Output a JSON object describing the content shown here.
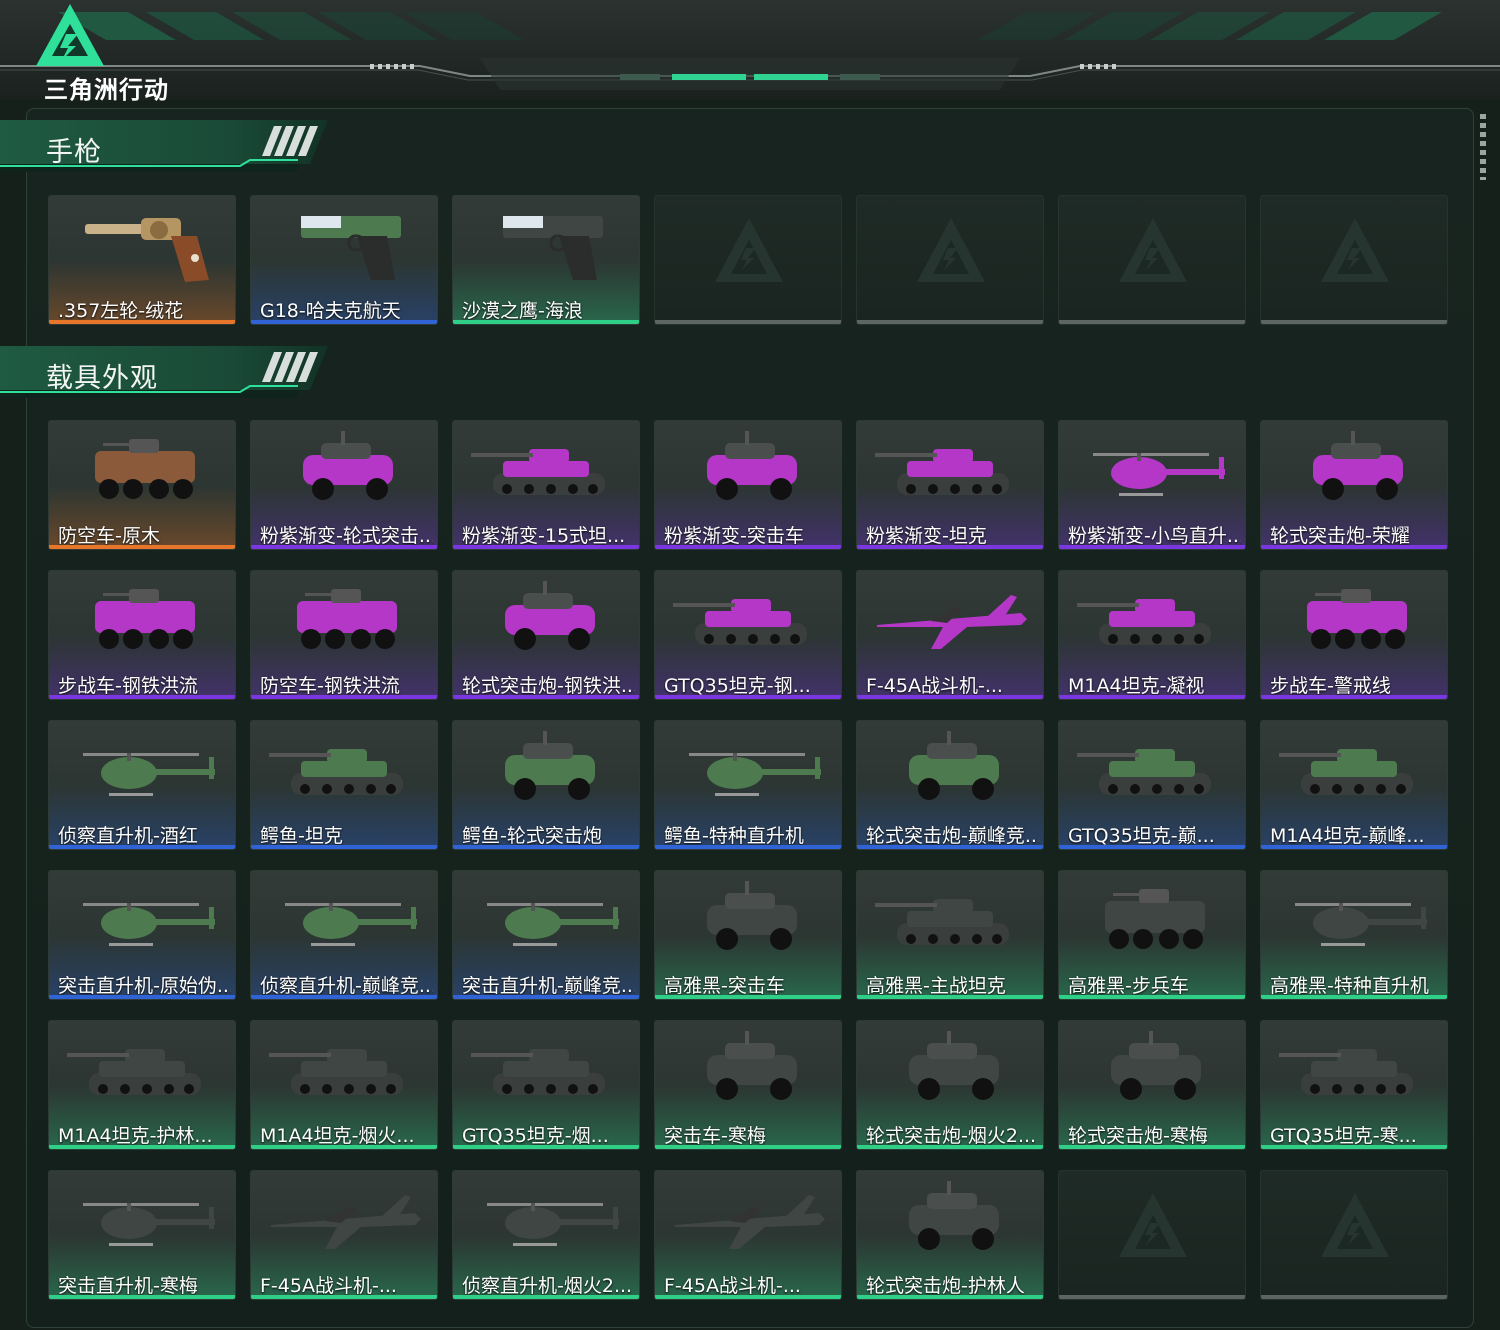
{
  "game": {
    "logo_text": "三角洲行动"
  },
  "rarity_colors": {
    "orange": "#e8762a",
    "blue": "#2f63d6",
    "purple": "#7a37e0",
    "green": "#2fcf88",
    "empty": "#5c6561"
  },
  "sections": [
    {
      "title": "手枪",
      "items": [
        {
          "label": ".357左轮-绒花",
          "rarity": "orange",
          "icon": "revolver"
        },
        {
          "label": "G18-哈夫克航天",
          "rarity": "blue",
          "icon": "pistol"
        },
        {
          "label": "沙漠之鹰-海浪",
          "rarity": "green",
          "icon": "pistol"
        },
        {
          "label": "",
          "rarity": "empty",
          "icon": ""
        },
        {
          "label": "",
          "rarity": "empty",
          "icon": ""
        },
        {
          "label": "",
          "rarity": "empty",
          "icon": ""
        },
        {
          "label": "",
          "rarity": "empty",
          "icon": ""
        }
      ]
    },
    {
      "title": "载具外观",
      "items": [
        {
          "label": "防空车-原木",
          "rarity": "orange",
          "icon": "apc"
        },
        {
          "label": "粉紫渐变-轮式突击...",
          "rarity": "purple",
          "icon": "car"
        },
        {
          "label": "粉紫渐变-15式坦...",
          "rarity": "purple",
          "icon": "tank"
        },
        {
          "label": "粉紫渐变-突击车",
          "rarity": "purple",
          "icon": "car"
        },
        {
          "label": "粉紫渐变-坦克",
          "rarity": "purple",
          "icon": "tank"
        },
        {
          "label": "粉紫渐变-小鸟直升...",
          "rarity": "purple",
          "icon": "heli"
        },
        {
          "label": "轮式突击炮-荣耀",
          "rarity": "purple",
          "icon": "car"
        },
        {
          "label": "步战车-钢铁洪流",
          "rarity": "purple",
          "icon": "apc"
        },
        {
          "label": "防空车-钢铁洪流",
          "rarity": "purple",
          "icon": "apc"
        },
        {
          "label": "轮式突击炮-钢铁洪...",
          "rarity": "purple",
          "icon": "car"
        },
        {
          "label": "GTQ35坦克-钢...",
          "rarity": "purple",
          "icon": "tank"
        },
        {
          "label": "F-45A战斗机-...",
          "rarity": "purple",
          "icon": "jet"
        },
        {
          "label": "M1A4坦克-凝视",
          "rarity": "purple",
          "icon": "tank"
        },
        {
          "label": "步战车-警戒线",
          "rarity": "purple",
          "icon": "apc"
        },
        {
          "label": "侦察直升机-酒红",
          "rarity": "blue",
          "icon": "heli"
        },
        {
          "label": "鳄鱼-坦克",
          "rarity": "blue",
          "icon": "tank"
        },
        {
          "label": "鳄鱼-轮式突击炮",
          "rarity": "blue",
          "icon": "car"
        },
        {
          "label": "鳄鱼-特种直升机",
          "rarity": "blue",
          "icon": "heli"
        },
        {
          "label": "轮式突击炮-巅峰竞...",
          "rarity": "blue",
          "icon": "car"
        },
        {
          "label": "GTQ35坦克-巅...",
          "rarity": "blue",
          "icon": "tank"
        },
        {
          "label": "M1A4坦克-巅峰...",
          "rarity": "blue",
          "icon": "tank"
        },
        {
          "label": "突击直升机-原始伪...",
          "rarity": "blue",
          "icon": "heli"
        },
        {
          "label": "侦察直升机-巅峰竞...",
          "rarity": "blue",
          "icon": "heli"
        },
        {
          "label": "突击直升机-巅峰竞...",
          "rarity": "blue",
          "icon": "heli"
        },
        {
          "label": "高雅黑-突击车",
          "rarity": "green",
          "icon": "car"
        },
        {
          "label": "高雅黑-主战坦克",
          "rarity": "green",
          "icon": "tank"
        },
        {
          "label": "高雅黑-步兵车",
          "rarity": "green",
          "icon": "apc"
        },
        {
          "label": "高雅黑-特种直升机",
          "rarity": "green",
          "icon": "heli"
        },
        {
          "label": "M1A4坦克-护林...",
          "rarity": "green",
          "icon": "tank"
        },
        {
          "label": "M1A4坦克-烟火...",
          "rarity": "green",
          "icon": "tank"
        },
        {
          "label": "GTQ35坦克-烟...",
          "rarity": "green",
          "icon": "tank"
        },
        {
          "label": "突击车-寒梅",
          "rarity": "green",
          "icon": "car"
        },
        {
          "label": "轮式突击炮-烟火2...",
          "rarity": "green",
          "icon": "car"
        },
        {
          "label": "轮式突击炮-寒梅",
          "rarity": "green",
          "icon": "car"
        },
        {
          "label": "GTQ35坦克-寒...",
          "rarity": "green",
          "icon": "tank"
        },
        {
          "label": "突击直升机-寒梅",
          "rarity": "green",
          "icon": "heli"
        },
        {
          "label": "F-45A战斗机-...",
          "rarity": "green",
          "icon": "jet"
        },
        {
          "label": "侦察直升机-烟火2...",
          "rarity": "green",
          "icon": "heli"
        },
        {
          "label": "F-45A战斗机-...",
          "rarity": "green",
          "icon": "jet"
        },
        {
          "label": "轮式突击炮-护林人",
          "rarity": "green",
          "icon": "car"
        },
        {
          "label": "",
          "rarity": "empty",
          "icon": ""
        },
        {
          "label": "",
          "rarity": "empty",
          "icon": ""
        }
      ]
    }
  ]
}
